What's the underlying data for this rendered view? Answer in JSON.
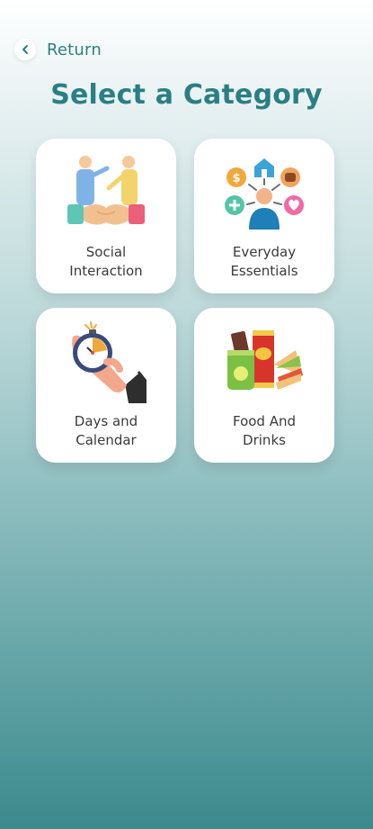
{
  "header": {
    "return_label": "Return",
    "title": "Select a Category"
  },
  "categories": [
    {
      "label": "Social\nInteraction",
      "icon": "handshake-icon"
    },
    {
      "label": "Everyday\nEssentials",
      "icon": "essentials-icon"
    },
    {
      "label": "Days and\nCalendar",
      "icon": "stopwatch-icon"
    },
    {
      "label": "Food And\nDrinks",
      "icon": "snacks-icon"
    }
  ],
  "colors": {
    "accent": "#2a7f83",
    "background_top": "#ffffff",
    "background_bottom": "#3b8a8d",
    "card": "#ffffff",
    "card_text": "#3a3a3a"
  }
}
